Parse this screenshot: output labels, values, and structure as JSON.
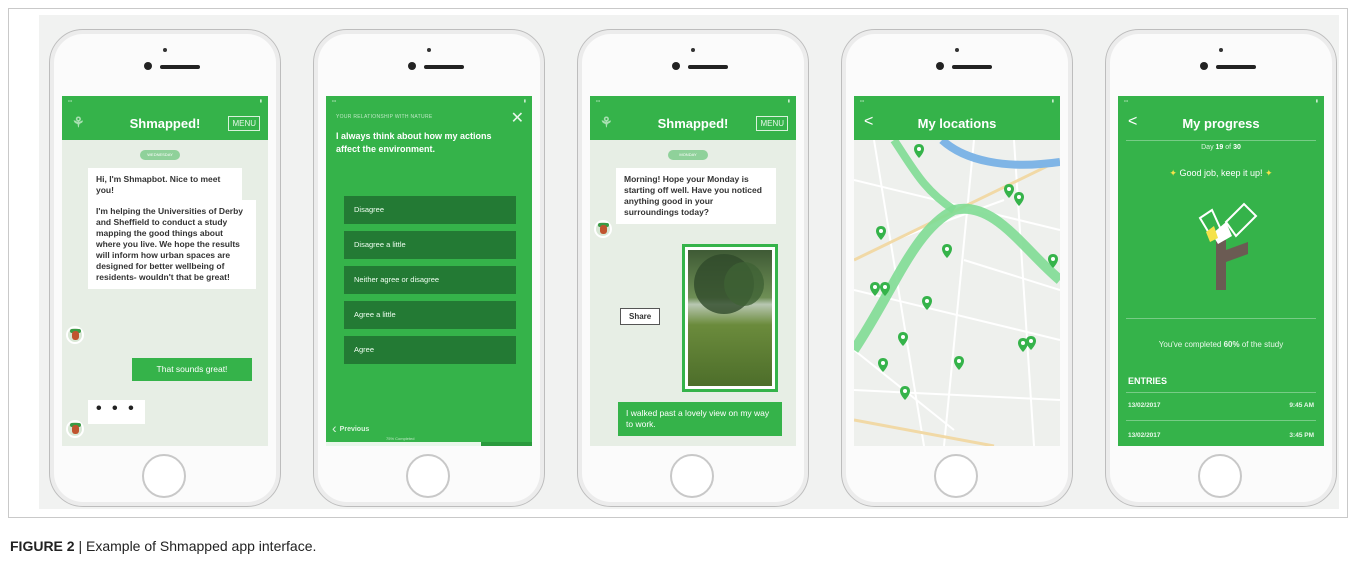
{
  "caption": {
    "label": "FIGURE 2",
    "separator": "|",
    "text": "Example of Shmapped app interface."
  },
  "phone1": {
    "app_title": "Shmapped!",
    "menu_label": "MENU",
    "day_pill": "WEDNESDAY",
    "messages": [
      "Hi, I'm Shmapbot. Nice to meet you!",
      "I'm helping the Universities of Derby and Sheffield to conduct a study mapping the good things about where you live. We hope the results will inform how urban spaces are designed for better wellbeing of residents- wouldn't that be great!"
    ],
    "reply": "That sounds great!",
    "typing": "• • •"
  },
  "phone2": {
    "category": "YOUR RELATIONSHIP WITH NATURE",
    "close": "✕",
    "question": "I always think about how my actions affect the environment.",
    "options": [
      "Disagree",
      "Disagree a little",
      "Neither agree or disagree",
      "Agree a little",
      "Agree"
    ],
    "previous_label": "Previous",
    "progress_label": "75% Completed",
    "progress_fraction": 0.75
  },
  "phone3": {
    "app_title": "Shmapped!",
    "menu_label": "MENU",
    "day_pill": "MONDAY",
    "message": "Morning! Hope your Monday is starting off well. Have you noticed anything good in your surroundings today?",
    "share_label": "Share",
    "reply": "I walked past a lovely view on my way to work."
  },
  "phone4": {
    "title": "My locations",
    "back": "<",
    "pin_color": "#35b34a",
    "route_color": "#7fdc93",
    "river_color": "#7fb5e6"
  },
  "phone5": {
    "title": "My progress",
    "back": "<",
    "day_prefix": "Day",
    "day_current": "19",
    "day_of": "of",
    "day_total": "30",
    "cheer": "Good job, keep it up!",
    "completed_prefix": "You've completed",
    "completed_percent": "60%",
    "completed_suffix": "of the study",
    "entries_title": "ENTRIES",
    "entries": [
      {
        "date": "13/02/2017",
        "time": "9:45 AM"
      },
      {
        "date": "13/02/2017",
        "time": "3:45 PM"
      }
    ]
  },
  "colors": {
    "accent": "#35b34a",
    "dark_option": "#237a34"
  }
}
